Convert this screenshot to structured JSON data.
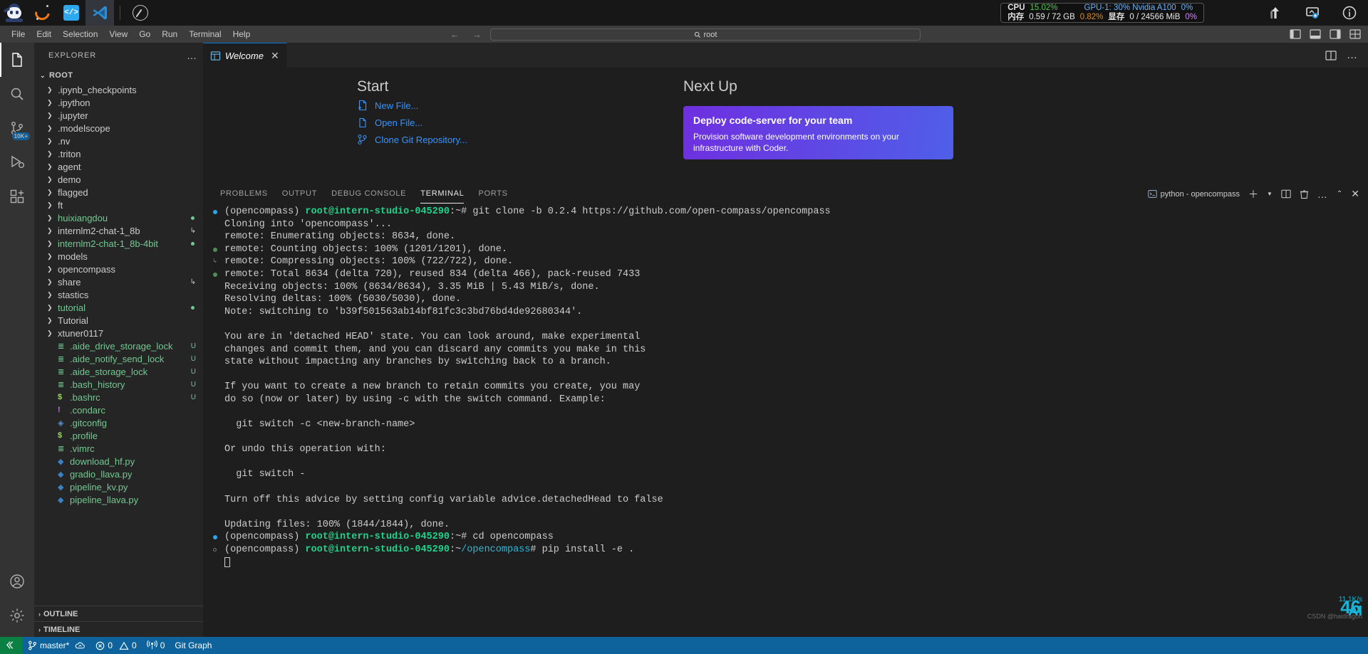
{
  "taskbar": {
    "apps": [
      {
        "name": "intern-monk-logo",
        "label": ""
      },
      {
        "name": "crescent-logo",
        "label": ""
      },
      {
        "name": "code-brackets-logo",
        "label": ""
      },
      {
        "name": "vscode-logo",
        "label": ""
      },
      {
        "name": "compass-logo",
        "label": ""
      }
    ],
    "sysmon": {
      "cpu_label": "CPU",
      "cpu_value": "15.02%",
      "gpu_label": "GPU-1: 30% Nvidia A100",
      "gpu_value": "0%",
      "mem_label": "内存",
      "mem_value": "0.59 / 72 GB",
      "mem_pct": "0.82%",
      "vram_label": "显存",
      "vram_value": "0 / 24566 MiB",
      "vram_pct": "0%"
    },
    "right_icons": [
      "network-upload-icon",
      "screen-share-icon",
      "info-icon"
    ]
  },
  "menubar": {
    "items": [
      "File",
      "Edit",
      "Selection",
      "View",
      "Go",
      "Run",
      "Terminal",
      "Help"
    ],
    "back_arrow": "←",
    "forward_arrow": "→",
    "search_value": "root",
    "search_icon": "search-icon"
  },
  "activitybar": {
    "items": [
      {
        "name": "explorer",
        "badge": ""
      },
      {
        "name": "search",
        "badge": ""
      },
      {
        "name": "source-control",
        "badge": "10K+"
      },
      {
        "name": "run-and-debug",
        "badge": ""
      },
      {
        "name": "extensions",
        "badge": ""
      }
    ],
    "bottom": [
      {
        "name": "accounts"
      },
      {
        "name": "settings-gear"
      }
    ]
  },
  "sidebar": {
    "title": "EXPLORER",
    "more_label": "…",
    "root_label": "ROOT",
    "root_chevron": "⌄",
    "tree": [
      {
        "label": ".ipynb_checkpoints",
        "type": "folder",
        "color": "normal",
        "badge": "",
        "dot": ""
      },
      {
        "label": ".ipython",
        "type": "folder",
        "color": "normal",
        "badge": "",
        "dot": ""
      },
      {
        "label": ".jupyter",
        "type": "folder",
        "color": "normal",
        "badge": "",
        "dot": ""
      },
      {
        "label": ".modelscope",
        "type": "folder",
        "color": "normal",
        "badge": "",
        "dot": ""
      },
      {
        "label": ".nv",
        "type": "folder",
        "color": "normal",
        "badge": "",
        "dot": ""
      },
      {
        "label": ".triton",
        "type": "folder",
        "color": "normal",
        "badge": "",
        "dot": ""
      },
      {
        "label": "agent",
        "type": "folder",
        "color": "normal",
        "badge": "",
        "dot": ""
      },
      {
        "label": "demo",
        "type": "folder",
        "color": "normal",
        "badge": "",
        "dot": ""
      },
      {
        "label": "flagged",
        "type": "folder",
        "color": "normal",
        "badge": "",
        "dot": ""
      },
      {
        "label": "ft",
        "type": "folder",
        "color": "normal",
        "badge": "",
        "dot": ""
      },
      {
        "label": "huixiangdou",
        "type": "folder",
        "color": "green",
        "badge": "",
        "dot": "green"
      },
      {
        "label": "internlm2-chat-1_8b",
        "type": "folder",
        "color": "normal",
        "badge": "↳",
        "dot": ""
      },
      {
        "label": "internlm2-chat-1_8b-4bit",
        "type": "folder",
        "color": "green",
        "badge": "",
        "dot": "green"
      },
      {
        "label": "models",
        "type": "folder",
        "color": "normal",
        "badge": "",
        "dot": ""
      },
      {
        "label": "opencompass",
        "type": "folder",
        "color": "normal",
        "badge": "",
        "dot": ""
      },
      {
        "label": "share",
        "type": "folder",
        "color": "normal",
        "badge": "↳",
        "dot": ""
      },
      {
        "label": "stastics",
        "type": "folder",
        "color": "normal",
        "badge": "",
        "dot": ""
      },
      {
        "label": "tutorial",
        "type": "folder",
        "color": "green",
        "badge": "",
        "dot": "green"
      },
      {
        "label": "Tutorial",
        "type": "folder",
        "color": "normal",
        "badge": "",
        "dot": ""
      },
      {
        "label": "xtuner0117",
        "type": "folder",
        "color": "normal",
        "badge": "",
        "dot": ""
      },
      {
        "label": ".aide_drive_storage_lock",
        "type": "file",
        "icon": "lines",
        "color": "green",
        "badge": "U",
        "dot": ""
      },
      {
        "label": ".aide_notify_send_lock",
        "type": "file",
        "icon": "lines",
        "color": "green",
        "badge": "U",
        "dot": ""
      },
      {
        "label": ".aide_storage_lock",
        "type": "file",
        "icon": "lines",
        "color": "green",
        "badge": "U",
        "dot": ""
      },
      {
        "label": ".bash_history",
        "type": "file",
        "icon": "lines",
        "color": "green",
        "badge": "U",
        "dot": ""
      },
      {
        "label": ".bashrc",
        "type": "file",
        "icon": "dollar",
        "color": "green",
        "badge": "U",
        "dot": ""
      },
      {
        "label": ".condarc",
        "type": "file",
        "icon": "bang",
        "color": "green",
        "badge": "",
        "dot": ""
      },
      {
        "label": ".gitconfig",
        "type": "file",
        "icon": "diamond",
        "color": "green",
        "badge": "",
        "dot": ""
      },
      {
        "label": ".profile",
        "type": "file",
        "icon": "dollar",
        "color": "green",
        "badge": "",
        "dot": ""
      },
      {
        "label": ".vimrc",
        "type": "file",
        "icon": "lines",
        "color": "green",
        "badge": "",
        "dot": ""
      },
      {
        "label": "download_hf.py",
        "type": "file",
        "icon": "python",
        "color": "green",
        "badge": "",
        "dot": ""
      },
      {
        "label": "gradio_llava.py",
        "type": "file",
        "icon": "python",
        "color": "green",
        "badge": "",
        "dot": ""
      },
      {
        "label": "pipeline_kv.py",
        "type": "file",
        "icon": "python",
        "color": "green",
        "badge": "",
        "dot": ""
      },
      {
        "label": "pipeline_llava.py",
        "type": "file",
        "icon": "python",
        "color": "green",
        "badge": "",
        "dot": ""
      }
    ],
    "sections": [
      {
        "label": "OUTLINE",
        "chevron": "›"
      },
      {
        "label": "TIMELINE",
        "chevron": "›"
      }
    ]
  },
  "editor": {
    "tab": {
      "label": "Welcome",
      "icon": "welcome-icon",
      "close": "✕"
    },
    "actions": [
      "split-editor-icon",
      "more-actions-icon"
    ]
  },
  "welcome": {
    "start_heading": "Start",
    "links": [
      {
        "label": "New File...",
        "icon": "new-file-icon"
      },
      {
        "label": "Open File...",
        "icon": "open-file-icon"
      },
      {
        "label": "Clone Git Repository...",
        "icon": "git-clone-icon"
      }
    ],
    "nextup_heading": "Next Up",
    "card_title": "Deploy code-server for your team",
    "card_body": "Provision software development environments on your infrastructure with Coder."
  },
  "panel": {
    "tabs": [
      {
        "label": "PROBLEMS",
        "active": false
      },
      {
        "label": "OUTPUT",
        "active": false
      },
      {
        "label": "DEBUG CONSOLE",
        "active": false
      },
      {
        "label": "TERMINAL",
        "active": true
      },
      {
        "label": "PORTS",
        "active": false
      }
    ],
    "terminal_name": "python - opencompass",
    "terminal_icon": "terminal-icon",
    "actions": [
      "new-terminal-icon",
      "split-terminal-icon",
      "kill-terminal-icon",
      "more-icon",
      "chevron-up-icon",
      "close-icon"
    ]
  },
  "terminal": {
    "prompt_env": "(opencompass) ",
    "prompt_user": "root@intern-studio-045290",
    "lines": [
      {
        "mark": "filled-b",
        "type": "prompt",
        "path": ":~",
        "cmd": "# git clone -b 0.2.4 https://github.com/open-compass/opencompass"
      },
      {
        "mark": "",
        "type": "out",
        "text": "Cloning into 'opencompass'..."
      },
      {
        "mark": "",
        "type": "out",
        "text": "remote: Enumerating objects: 8634, done."
      },
      {
        "mark": "filled-g",
        "type": "out",
        "text": "remote: Counting objects: 100% (1201/1201), done."
      },
      {
        "mark": "arrow",
        "type": "out",
        "text": "remote: Compressing objects: 100% (722/722), done."
      },
      {
        "mark": "filled-g",
        "type": "out",
        "text": "remote: Total 8634 (delta 720), reused 834 (delta 466), pack-reused 7433"
      },
      {
        "mark": "",
        "type": "out",
        "text": "Receiving objects: 100% (8634/8634), 3.35 MiB | 5.43 MiB/s, done."
      },
      {
        "mark": "",
        "type": "out",
        "text": "Resolving deltas: 100% (5030/5030), done."
      },
      {
        "mark": "",
        "type": "out",
        "text": "Note: switching to 'b39f501563ab14bf81fc3c3bd76bd4de92680344'."
      },
      {
        "mark": "",
        "type": "out",
        "text": ""
      },
      {
        "mark": "",
        "type": "out",
        "text": "You are in 'detached HEAD' state. You can look around, make experimental"
      },
      {
        "mark": "",
        "type": "out",
        "text": "changes and commit them, and you can discard any commits you make in this"
      },
      {
        "mark": "",
        "type": "out",
        "text": "state without impacting any branches by switching back to a branch."
      },
      {
        "mark": "",
        "type": "out",
        "text": ""
      },
      {
        "mark": "",
        "type": "out",
        "text": "If you want to create a new branch to retain commits you create, you may"
      },
      {
        "mark": "",
        "type": "out",
        "text": "do so (now or later) by using -c with the switch command. Example:"
      },
      {
        "mark": "",
        "type": "out",
        "text": ""
      },
      {
        "mark": "",
        "type": "out",
        "text": "  git switch -c <new-branch-name>"
      },
      {
        "mark": "",
        "type": "out",
        "text": ""
      },
      {
        "mark": "",
        "type": "out",
        "text": "Or undo this operation with:"
      },
      {
        "mark": "",
        "type": "out",
        "text": ""
      },
      {
        "mark": "",
        "type": "out",
        "text": "  git switch -"
      },
      {
        "mark": "",
        "type": "out",
        "text": ""
      },
      {
        "mark": "",
        "type": "out",
        "text": "Turn off this advice by setting config variable advice.detachedHead to false"
      },
      {
        "mark": "",
        "type": "out",
        "text": ""
      },
      {
        "mark": "",
        "type": "out",
        "text": "Updating files: 100% (1844/1844), done."
      },
      {
        "mark": "filled-b",
        "type": "prompt",
        "path": ":~",
        "cmd": "# cd opencompass"
      },
      {
        "mark": "ring",
        "type": "prompt2",
        "path": ":~",
        "path2": "/opencompass",
        "cmd": "# pip install -e ."
      }
    ]
  },
  "statusbar": {
    "remote_icon": "remote-connection-icon",
    "items": [
      {
        "name": "branch",
        "icon": "branch-icon",
        "label": "master*"
      },
      {
        "name": "sync",
        "icon": "sync-cloud-icon",
        "label": ""
      },
      {
        "name": "errors",
        "icon": "error-icon",
        "label": "0"
      },
      {
        "name": "warnings",
        "icon": "warning-icon",
        "label": "0"
      },
      {
        "name": "ports",
        "icon": "radio-tower-icon",
        "label": "0"
      },
      {
        "name": "git-graph",
        "icon": "",
        "label": "Git Graph"
      }
    ]
  },
  "watermark": {
    "net_speed": "11.1K/s",
    "ai_label": "AI",
    "number": "46",
    "sub": "CSDN @haidragon"
  },
  "colors": {
    "accent": "#0078d4",
    "statusbar_bg": "#0e639c",
    "remote_bg": "#0a8043",
    "git_green": "#73c991",
    "terminal_green": "#23d18b",
    "card_purple": "#6f2fe0",
    "link_blue": "#3794ff"
  }
}
